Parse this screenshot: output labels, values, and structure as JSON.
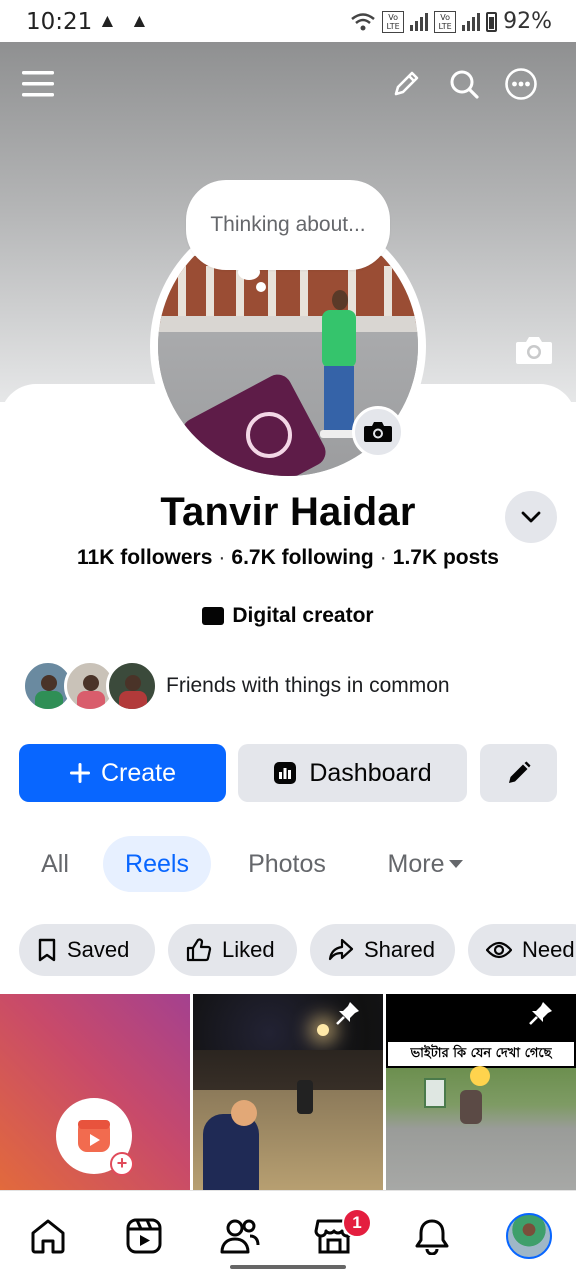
{
  "status_bar": {
    "time": "10:21",
    "battery": "92%",
    "warning_count": 2
  },
  "top_bar": {
    "icons": [
      "menu-icon",
      "pencil-icon",
      "search-icon",
      "more-icon"
    ]
  },
  "profile": {
    "thought_bubble": "Thinking about...",
    "name": "Tanvir Haidar",
    "followers": "11K followers",
    "following": "6.7K following",
    "posts": "1.7K posts",
    "separator": "·",
    "category": "Digital creator",
    "mutual_text": "Friends with things in common"
  },
  "actions": {
    "create_label": "Create",
    "dashboard_label": "Dashboard"
  },
  "tabs": [
    {
      "label": "All",
      "active": false
    },
    {
      "label": "Reels",
      "active": true
    },
    {
      "label": "Photos",
      "active": false
    },
    {
      "label": "More",
      "active": false
    }
  ],
  "filters": [
    {
      "label": "Saved",
      "icon": "bookmark-icon"
    },
    {
      "label": "Liked",
      "icon": "thumbs-up-icon"
    },
    {
      "label": "Shared",
      "icon": "share-icon"
    },
    {
      "label": "Need",
      "icon": "eye-icon"
    }
  ],
  "reels": {
    "tile3_caption": "ভাইটার কি যেন দেখা গেছে"
  },
  "bottom_nav": {
    "items": [
      "home-icon",
      "video-icon",
      "friends-icon",
      "marketplace-icon",
      "notifications-icon",
      "profile-avatar"
    ],
    "marketplace_badge": "1"
  },
  "colors": {
    "accent": "#0866ff",
    "chip_bg": "#e4e6eb",
    "badge": "#e41e3f"
  }
}
